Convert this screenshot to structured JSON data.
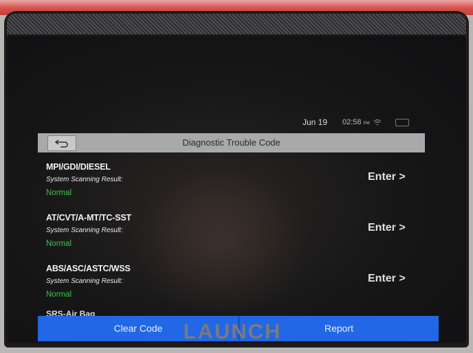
{
  "status_bar": {
    "date": "Jun 19",
    "time": "02:58",
    "meridiem": "PM"
  },
  "header": {
    "title": "Diagnostic Trouble Code"
  },
  "systems": [
    {
      "name": "MPI/GDI/DIESEL",
      "scan_label": "System Scanning Result:",
      "result": "Normal",
      "action": "Enter >"
    },
    {
      "name": "AT/CVT/A-MT/TC-SST",
      "scan_label": "System Scanning Result:",
      "result": "Normal",
      "action": "Enter >"
    },
    {
      "name": "ABS/ASC/ASTC/WSS",
      "scan_label": "System Scanning Result:",
      "result": "Normal",
      "action": "Enter >"
    }
  ],
  "partial_item": "SRS-Air Bag",
  "footer": {
    "clear_label": "Clear Code",
    "report_label": "Report"
  },
  "device": {
    "brand": "LAUNCH"
  },
  "colors": {
    "accent": "#2167e6",
    "normal": "#3fc24a",
    "device_red": "#d8504c"
  }
}
